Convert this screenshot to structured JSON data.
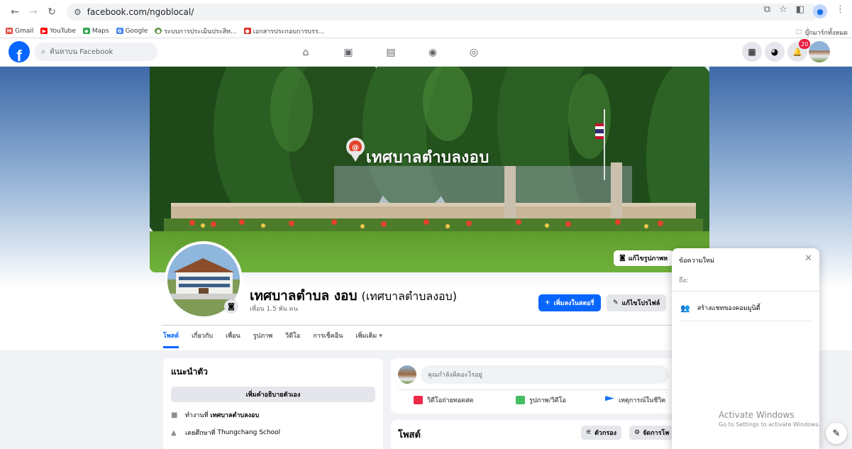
{
  "browser": {
    "url": "facebook.com/ngoblocal/",
    "bookmarks": [
      {
        "label": "Gmail",
        "color": "#ea4335",
        "glyph": "M"
      },
      {
        "label": "YouTube",
        "color": "#ff0000",
        "glyph": "▶"
      },
      {
        "label": "Maps",
        "color": "#34a853",
        "glyph": "◆"
      },
      {
        "label": "Google",
        "color": "#4285f4",
        "glyph": "G"
      },
      {
        "label": "ระบบการประเมินประสิท...",
        "color": "#5b8f3a",
        "glyph": "●"
      },
      {
        "label": "เอกสารประกอบการบรร...",
        "color": "#d93025",
        "glyph": "●"
      }
    ],
    "bookmarks_folder": "บุ๊กมาร์กทั้งหมด"
  },
  "facebook": {
    "logo": "f",
    "search_placeholder": "ค้นหาบน Facebook",
    "notification_count": "20"
  },
  "cover": {
    "sign_text": "เทศบาลตำบลงอบ",
    "edit_cover_label": "แก้ไขรูปภาพห"
  },
  "profile": {
    "name": "เทศบาลตำบล งอบ",
    "alt_name": "(เทศบาลตำบลงอบ)",
    "friends": "เพื่อน 1.5 พัน คน",
    "add_story_label": "เพิ่มลงในสตอรี่",
    "edit_profile_label": "แก้ไขโปรไฟล์"
  },
  "tabs": [
    "โพสต์",
    "เกี่ยวกับ",
    "เพื่อน",
    "รูปภาพ",
    "วิดีโอ",
    "การเช็คอิน",
    "เพิ่มเติม ▾"
  ],
  "intro": {
    "title": "แนะนำตัว",
    "add_bio_label": "เพิ่มคำอธิบายตัวเอง",
    "work_prefix": "ทำงานที่",
    "work_place": "เทศบาลตำบลงอบ",
    "study_prefix": "เคยศึกษาที่",
    "study_place": "Thungchang School"
  },
  "composer": {
    "placeholder": "คุณกำลังคิดอะไรอยู่",
    "live_label": "วิดีโอถ่ายทอดสด",
    "photo_label": "รูปภาพ/วิดีโอ",
    "event_label": "เหตุการณ์ในชีวิต",
    "colors": {
      "live": "#f02849",
      "photo": "#45bd62",
      "event": "#1877f2"
    }
  },
  "posts": {
    "title": "โพสต์",
    "filter_label": "ตัวกรอง",
    "manage_label": "จัดการโพ"
  },
  "message_panel": {
    "title": "ข้อความใหม่",
    "to_label": "ถึง:",
    "create_chat_label": "สร้างแชทของคอมมูนิตี้"
  },
  "watermark": {
    "line1": "Activate Windows",
    "line2": "Go to Settings to activate Windows."
  }
}
